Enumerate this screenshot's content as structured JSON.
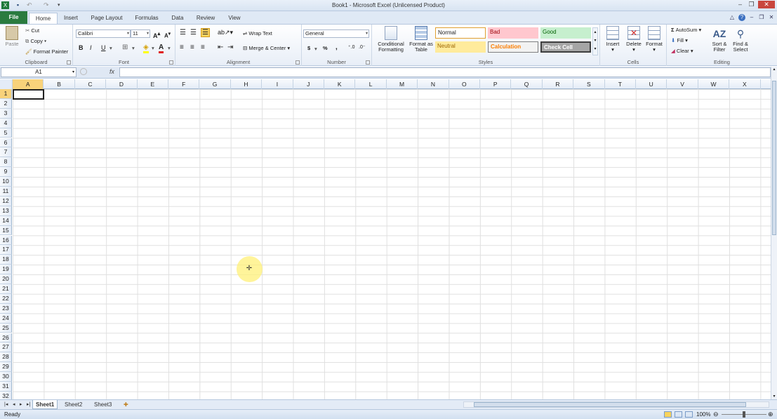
{
  "window": {
    "title": "Book1 - Microsoft Excel (Unlicensed Product)"
  },
  "tabs": {
    "file": "File",
    "home": "Home",
    "insert": "Insert",
    "page_layout": "Page Layout",
    "formulas": "Formulas",
    "data": "Data",
    "review": "Review",
    "view": "View"
  },
  "clipboard": {
    "paste": "Paste",
    "cut": "Cut",
    "copy": "Copy",
    "format_painter": "Format Painter",
    "label": "Clipboard"
  },
  "font": {
    "name": "Calibri",
    "size": "11",
    "label": "Font",
    "bold": "B",
    "italic": "I",
    "underline": "U"
  },
  "alignment": {
    "wrap_text": "Wrap Text",
    "merge_center": "Merge & Center",
    "label": "Alignment"
  },
  "number": {
    "format": "General",
    "currency": "$",
    "percent": "%",
    "comma": ",",
    "label": "Number"
  },
  "styles": {
    "conditional_formatting": "Conditional Formatting",
    "format_as_table": "Format as Table",
    "normal": "Normal",
    "bad": "Bad",
    "good": "Good",
    "neutral": "Neutral",
    "calculation": "Calculation",
    "check_cell": "Check Cell",
    "label": "Styles"
  },
  "cells_group": {
    "insert": "Insert",
    "delete": "Delete",
    "format": "Format",
    "label": "Cells"
  },
  "editing": {
    "autosum": "AutoSum",
    "fill": "Fill",
    "clear": "Clear",
    "sort_filter": "Sort & Filter",
    "find_select": "Find & Select",
    "label": "Editing"
  },
  "formula_bar": {
    "name_box": "A1",
    "fx": "fx"
  },
  "columns": [
    "A",
    "B",
    "C",
    "D",
    "E",
    "F",
    "G",
    "H",
    "I",
    "J",
    "K",
    "L",
    "M",
    "N",
    "O",
    "P",
    "Q",
    "R",
    "S",
    "T",
    "U",
    "V",
    "W",
    "X"
  ],
  "rows": [
    "1",
    "2",
    "3",
    "4",
    "5",
    "6",
    "7",
    "8",
    "9",
    "10",
    "11",
    "12",
    "13",
    "14",
    "15",
    "16",
    "17",
    "18",
    "19",
    "20",
    "21",
    "22",
    "23",
    "24",
    "25",
    "26",
    "27",
    "28",
    "29",
    "30",
    "31",
    "32"
  ],
  "sheets": [
    "Sheet1",
    "Sheet2",
    "Sheet3"
  ],
  "status": {
    "ready": "Ready",
    "zoom": "100%"
  },
  "colors": {
    "file_tab": "#2a7b3f",
    "normal_border": "#e0a030",
    "bad_bg": "#ffc7ce",
    "good_bg": "#c6efce",
    "neutral_bg": "#ffeb9c",
    "check_bg": "#a5a5a5"
  }
}
